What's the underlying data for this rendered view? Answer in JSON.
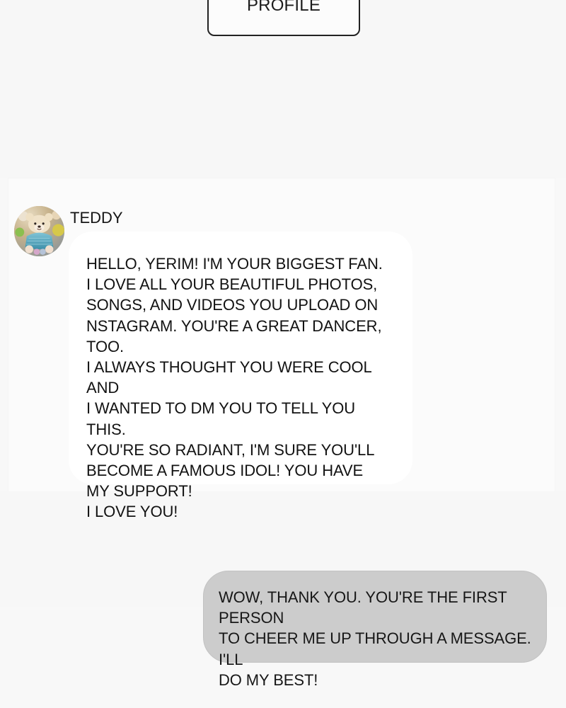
{
  "header": {
    "profile_button_label": "PROFILE"
  },
  "conversation": {
    "incoming": {
      "sender_name": "TEDDY",
      "avatar_icon": "teddy-bear-avatar-icon",
      "message": "HELLO, YERIM! I'M YOUR BIGGEST FAN.\nI LOVE ALL YOUR BEAUTIFUL PHOTOS,\nSONGS, AND VIDEOS YOU UPLOAD ON\nNSTAGRAM. YOU'RE A GREAT DANCER, TOO.\nI ALWAYS THOUGHT YOU WERE COOL AND\nI WANTED TO DM YOU TO TELL YOU THIS.\nYOU'RE SO RADIANT, I'M SURE YOU'LL\nBECOME A FAMOUS IDOL! YOU HAVE\nMY SUPPORT!\nI LOVE YOU!"
    },
    "outgoing": {
      "message": "WOW, THANK YOU. YOU'RE THE FIRST PERSON\nTO CHEER ME UP THROUGH A MESSAGE. I'LL\nDO MY BEST!"
    }
  },
  "colors": {
    "page_background": "#f8f8f8",
    "incoming_bubble": "#ffffff",
    "outgoing_bubble": "#cccccc",
    "text": "#111111",
    "profile_border": "#222222"
  }
}
